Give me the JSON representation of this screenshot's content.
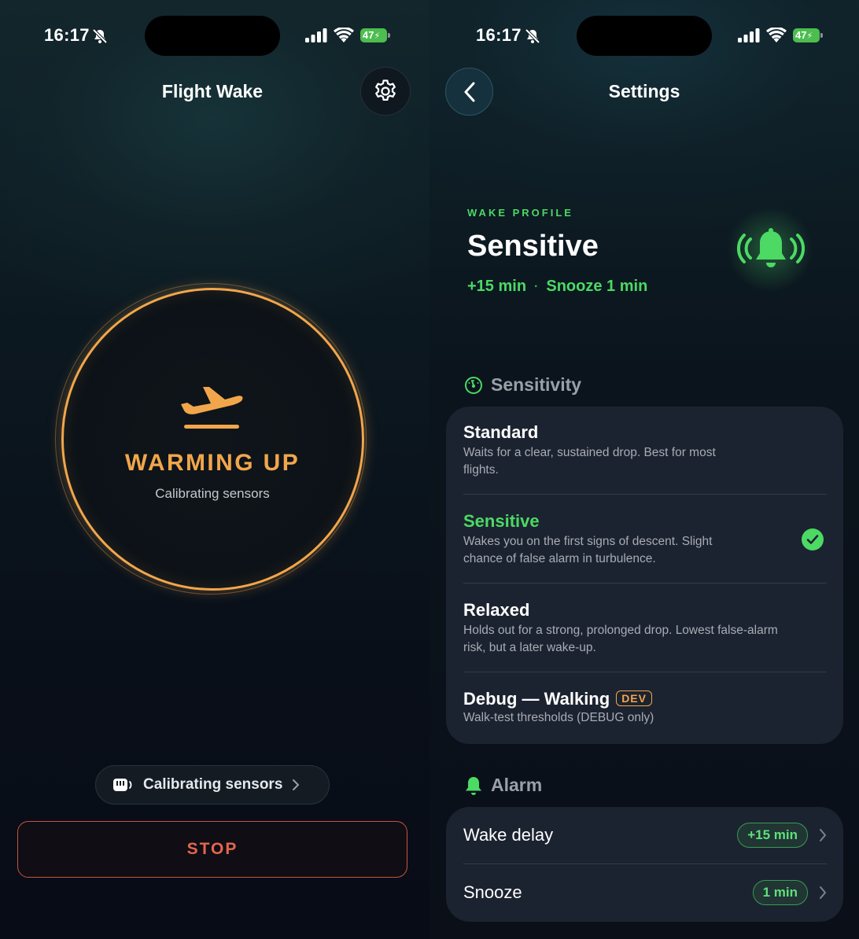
{
  "left": {
    "status": {
      "time": "16:17",
      "battery": "47"
    },
    "header": {
      "title": "Flight Wake"
    },
    "ring": {
      "title": "WARMING UP",
      "subtitle": "Calibrating sensors"
    },
    "pill": {
      "label": "Calibrating sensors"
    },
    "stop_label": "STOP"
  },
  "right": {
    "status": {
      "time": "16:17",
      "battery": "47"
    },
    "header": {
      "title": "Settings"
    },
    "profile": {
      "label": "WAKE PROFILE",
      "name": "Sensitive",
      "delay": "+15 min",
      "separator": "·",
      "snooze": "Snooze 1 min"
    },
    "sensitivity": {
      "header": "Sensitivity",
      "options": [
        {
          "name": "Standard",
          "desc": "Waits for a clear, sustained drop. Best for most flights.",
          "selected": false
        },
        {
          "name": "Sensitive",
          "desc": "Wakes you on the first signs of descent. Slight chance of false alarm in turbulence.",
          "selected": true
        },
        {
          "name": "Relaxed",
          "desc": "Holds out for a strong, prolonged drop. Lowest false-alarm risk, but a later wake-up.",
          "selected": false
        },
        {
          "name": "Debug — Walking",
          "badge": "DEV",
          "desc": "Walk-test thresholds (DEBUG only)",
          "selected": false
        }
      ]
    },
    "alarm": {
      "header": "Alarm",
      "rows": [
        {
          "label": "Wake delay",
          "value": "+15 min"
        },
        {
          "label": "Snooze",
          "value": "1 min"
        }
      ]
    }
  },
  "colors": {
    "accent_orange": "#f2a64b",
    "accent_green": "#4cd964",
    "stop_red": "#e2674c",
    "card_bg": "#1c2330"
  }
}
